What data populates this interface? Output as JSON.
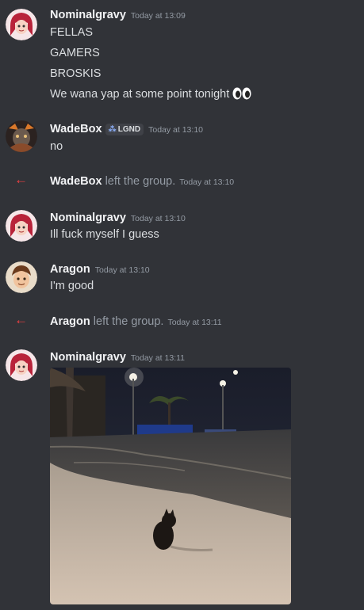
{
  "messages": [
    {
      "username": "Nominalgravy",
      "timestamp": "Today at 13:09",
      "lines": [
        "FELLAS",
        "GAMERS",
        "BROSKIS",
        "We wana yap at some point tonight"
      ]
    },
    {
      "username": "WadeBox",
      "badge": "LGND",
      "badge_icon": "guild-tag-icon",
      "timestamp": "Today at 13:10",
      "lines": [
        "no"
      ]
    },
    {
      "username": "Nominalgravy",
      "timestamp": "Today at 13:10",
      "lines": [
        "Ill fuck myself I guess"
      ]
    },
    {
      "username": "Aragon",
      "timestamp": "Today at 13:10",
      "lines": [
        "I'm good"
      ]
    },
    {
      "username": "Nominalgravy",
      "timestamp": "Today at 13:11",
      "attachment": "gif"
    }
  ],
  "system": [
    {
      "username": "WadeBox",
      "text": "left the group.",
      "timestamp": "Today at 13:10",
      "icon": "leave-arrow-icon"
    },
    {
      "username": "Aragon",
      "text": "left the group.",
      "timestamp": "Today at 13:11",
      "icon": "leave-arrow-icon"
    }
  ],
  "colors": {
    "background": "#313338",
    "leave_arrow": "#f23f42",
    "username": "#f2f3f5",
    "timestamp": "#949ba4"
  }
}
